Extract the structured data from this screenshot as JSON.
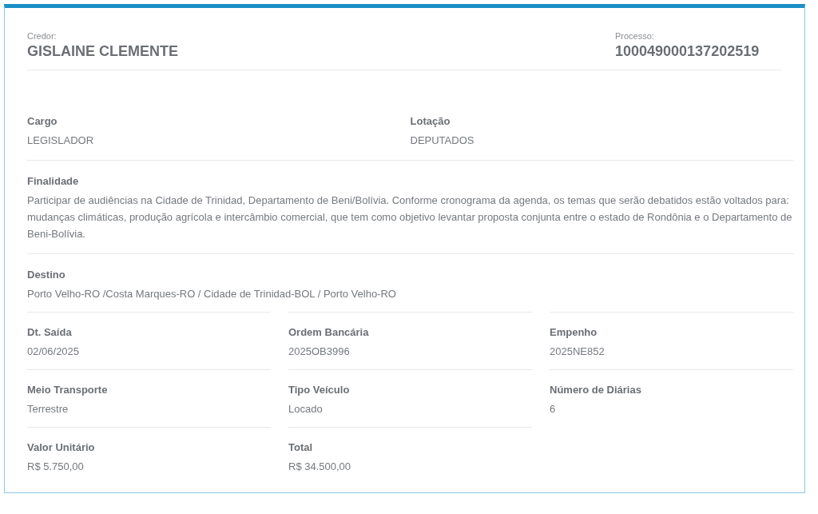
{
  "header": {
    "creditor": {
      "label": "Credor:",
      "value": "GISLAINE CLEMENTE"
    },
    "process": {
      "label": "Processo:",
      "value": "100049000137202519"
    }
  },
  "pair": [
    {
      "label": "Cargo",
      "value": "LEGISLADOR"
    },
    {
      "label": "Lotação",
      "value": "DEPUTADOS"
    }
  ],
  "purpose": {
    "label": "Finalidade",
    "value": "Participar de audiências na Cidade de Trinidad, Departamento de Beni/Bolívia. Conforme cronograma da agenda, os temas que serão debatidos estão voltados para: mudanças climáticas, produção agrícola e intercâmbio comercial, que tem como objetivo levantar proposta conjunta entre o estado de Rondônia e o Departamento de Beni-Bolívia."
  },
  "destination": {
    "label": "Destino",
    "value": "Porto Velho-RO /Costa Marques-RO / Cidade de Trinidad-BOL / Porto Velho-RO"
  },
  "grid": [
    {
      "label": "Dt. Saída",
      "value": "02/06/2025"
    },
    {
      "label": "Ordem Bancária",
      "value": "2025OB3996"
    },
    {
      "label": "Empenho",
      "value": "2025NE852"
    },
    {
      "label": "Meio Transporte",
      "value": "Terrestre"
    },
    {
      "label": "Tipo Veículo",
      "value": "Locado"
    },
    {
      "label": "Número de Diárias",
      "value": "6"
    },
    {
      "label": "Valor Unitário",
      "value": "R$ 5.750,00"
    },
    {
      "label": "Total",
      "value": "R$ 34.500,00"
    }
  ]
}
